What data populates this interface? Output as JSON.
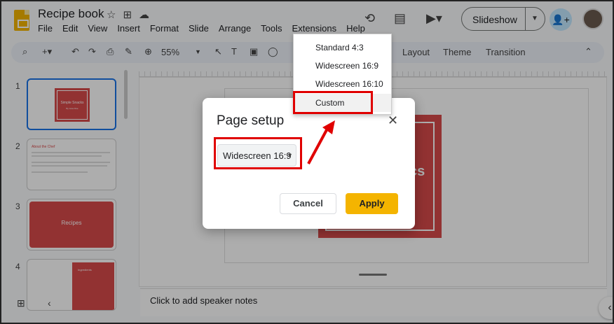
{
  "header": {
    "doc_title": "Recipe book",
    "menu": [
      "File",
      "Edit",
      "View",
      "Insert",
      "Format",
      "Slide",
      "Arrange",
      "Tools",
      "Extensions",
      "Help"
    ],
    "slideshow_label": "Slideshow"
  },
  "toolbar": {
    "zoom": "55%",
    "layout_label": "Layout",
    "theme_label": "Theme",
    "transition_label": "Transition"
  },
  "filmstrip": {
    "slides": [
      {
        "num": "1",
        "title": "Simple Snacks",
        "subtitle": "By Jane Doe"
      },
      {
        "num": "2",
        "title": "About the Chef"
      },
      {
        "num": "3",
        "title": "Recipes"
      },
      {
        "num": "4",
        "title": "Ingredients"
      }
    ]
  },
  "canvas": {
    "visible_text": "cs"
  },
  "notes": {
    "placeholder": "Click to add speaker notes"
  },
  "dialog": {
    "title": "Page setup",
    "selected": "Widescreen 16:9",
    "cancel": "Cancel",
    "apply": "Apply"
  },
  "dropdown": {
    "options": [
      "Standard 4:3",
      "Widescreen 16:9",
      "Widescreen 16:10",
      "Custom"
    ],
    "highlighted": "Custom"
  },
  "colors": {
    "accent_red": "#d84a4a",
    "apply_yellow": "#f4b400",
    "annotation_red": "#e00000",
    "selection_blue": "#1a73e8"
  }
}
